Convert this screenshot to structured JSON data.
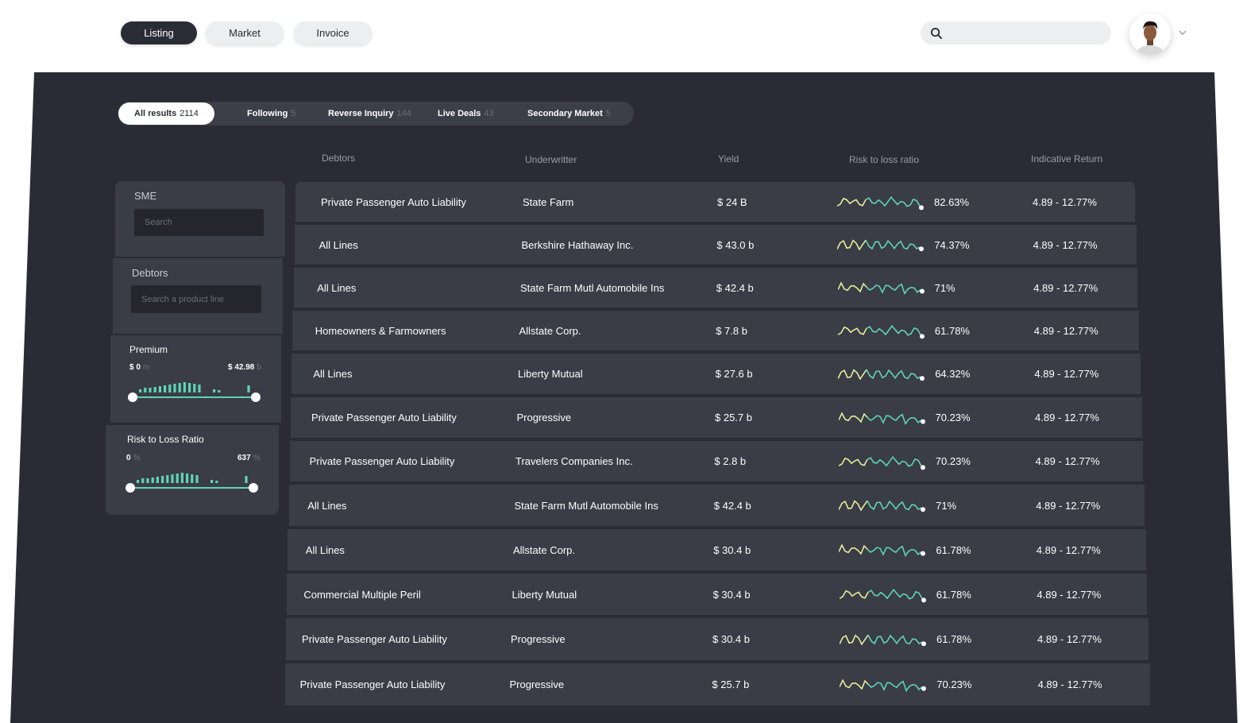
{
  "nav": {
    "tabs": [
      {
        "label": "Listing",
        "active": true
      },
      {
        "label": "Market",
        "active": false
      },
      {
        "label": "Invoice",
        "active": false
      }
    ],
    "search_icon": "search-icon",
    "avatar_icon": "user-avatar",
    "menu_icon": "chevron-down-icon"
  },
  "result_tabs": [
    {
      "label": "All results",
      "count": "2114",
      "active": true
    },
    {
      "label": "Following",
      "count": "5",
      "active": false
    },
    {
      "label": "Reverse Inquiry",
      "count": "144",
      "active": false
    },
    {
      "label": "Live Deals",
      "count": "43",
      "active": false
    },
    {
      "label": "Secondary Market",
      "count": "5",
      "active": false
    }
  ],
  "columns": {
    "debtors": "Debtors",
    "underwriter": "Underwritter",
    "yield": "Yield",
    "risk": "Risk to loss ratio",
    "return": "Indicative Return"
  },
  "filters": {
    "sme": {
      "label": "SME",
      "placeholder": "Search"
    },
    "debtors": {
      "label": "Debtors",
      "placeholder": "Search a product line"
    },
    "premium": {
      "label": "Premium",
      "min": "$ 0",
      "min_unit": "m",
      "max": "$ 42.98",
      "max_unit": "b"
    },
    "risk": {
      "label": "Risk to Loss Ratio",
      "min": "0",
      "min_unit": "%",
      "max": "637",
      "max_unit": "%"
    }
  },
  "colors": {
    "panel": "#2a2b34",
    "row": "#3a3c46",
    "accent_teal": "#5fd3b5",
    "accent_yellow": "#e6ec9a"
  },
  "rows": [
    {
      "debtor": "Private Passenger Auto Liability",
      "underwriter": "State Farm",
      "yield": "$ 24 B",
      "risk": "82.63%",
      "return": "4.89 - 12.77%"
    },
    {
      "debtor": "All Lines",
      "underwriter": "Berkshire Hathaway Inc.",
      "yield": "$ 43.0 b",
      "risk": "74.37%",
      "return": "4.89 - 12.77%"
    },
    {
      "debtor": "All Lines",
      "underwriter": "State Farm Mutl Automobile Ins",
      "yield": "$ 42.4 b",
      "risk": "71%",
      "return": "4.89 - 12.77%"
    },
    {
      "debtor": "Homeowners & Farmowners",
      "underwriter": "Allstate Corp.",
      "yield": "$ 7.8 b",
      "risk": "61.78%",
      "return": "4.89 - 12.77%"
    },
    {
      "debtor": "All Lines",
      "underwriter": "Liberty Mutual",
      "yield": "$ 27.6 b",
      "risk": "64.32%",
      "return": "4.89 - 12.77%"
    },
    {
      "debtor": "Private Passenger Auto Liability",
      "underwriter": "Progressive",
      "yield": "$ 25.7 b",
      "risk": "70.23%",
      "return": "4.89 - 12.77%"
    },
    {
      "debtor": "Private Passenger Auto Liability",
      "underwriter": "Travelers Companies Inc.",
      "yield": "$ 2.8 b",
      "risk": "70.23%",
      "return": "4.89 - 12.77%"
    },
    {
      "debtor": "All Lines",
      "underwriter": "State Farm Mutl Automobile Ins",
      "yield": "$ 42.4 b",
      "risk": "71%",
      "return": "4.89 - 12.77%"
    },
    {
      "debtor": "All Lines",
      "underwriter": "Allstate Corp.",
      "yield": "$ 30.4 b",
      "risk": "61.78%",
      "return": "4.89 - 12.77%"
    },
    {
      "debtor": "Commercial Multiple Peril",
      "underwriter": "Liberty Mutual",
      "yield": "$ 30.4 b",
      "risk": "61.78%",
      "return": "4.89 - 12.77%"
    },
    {
      "debtor": "Private Passenger Auto Liability",
      "underwriter": "Progressive",
      "yield": "$ 30.4 b",
      "risk": "61.78%",
      "return": "4.89 - 12.77%"
    },
    {
      "debtor": "Private Passenger Auto Liability",
      "underwriter": "Progressive",
      "yield": "$ 25.7 b",
      "risk": "70.23%",
      "return": "4.89 - 12.77%"
    }
  ]
}
